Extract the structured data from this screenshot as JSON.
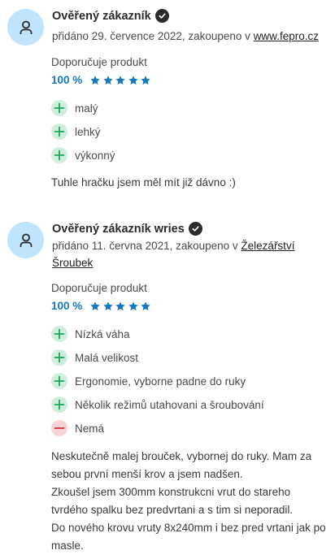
{
  "colors": {
    "avatar_bg": "#bfe4fb",
    "rating_blue": "#1478c2",
    "pro_bg": "#cfeedd",
    "pro_icon": "#22a45d",
    "con_bg": "#f8d3d6",
    "con_icon": "#d9303f"
  },
  "reviews": [
    {
      "author": "Ověřený zákazník",
      "meta_prefix": "přidáno 29. července 2022, zakoupeno v ",
      "shop": "www.fepro.cz",
      "recommend_label": "Doporučuje produkt",
      "rating_percent": "100 %",
      "stars": 5,
      "pros": [
        "malý",
        "lehký",
        "výkonný"
      ],
      "cons": [],
      "text": [
        "Tuhle hračku jsem měl mít již dávno :)"
      ]
    },
    {
      "author": "Ověřený zákazník wries",
      "meta_prefix": "přidáno 11. června 2021, zakoupeno v ",
      "shop": "Železářství Šroubek",
      "recommend_label": "Doporučuje produkt",
      "rating_percent": "100 %",
      "stars": 5,
      "pros": [
        "Nízká váha",
        "Malá velikost",
        "Ergonomie, vyborne padne do ruky",
        "Několik režimů utahovani a šroubování"
      ],
      "cons": [
        "Nemá"
      ],
      "text": [
        "Neskutečně malej brouček, vybornej do ruky. Mam za sebou první menší krov a jsem nadšen.",
        "Zkoušel jsem 300mm konstrukcni vrut do stareho tvrdého spalku bez predvrtani a s tim si neporadil.",
        "Do nového krovu vruty 8x240mm i bez pred vrtani jak po masle."
      ]
    }
  ]
}
